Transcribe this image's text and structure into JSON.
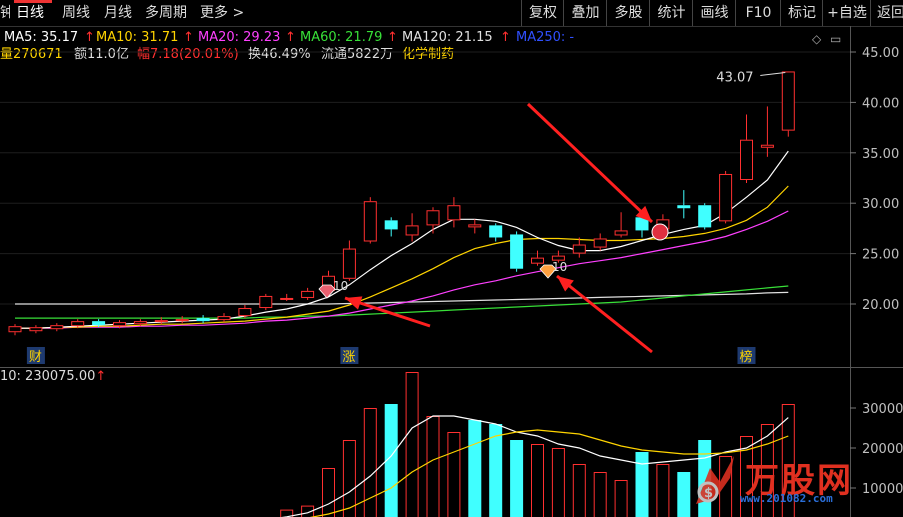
{
  "toolbar": {
    "left_tabs": [
      {
        "label": "日线",
        "active": true
      },
      {
        "label": "周线",
        "active": false
      },
      {
        "label": "月线",
        "active": false
      },
      {
        "label": "多周期",
        "active": false
      },
      {
        "label": "更多 >",
        "active": false
      }
    ],
    "left_cut_label": "钟",
    "right_buttons": [
      "复权",
      "叠加",
      "多股",
      "统计",
      "画线",
      "F10",
      "标记",
      "+自选",
      "返回"
    ]
  },
  "ma_legend": [
    {
      "label": "MA5: 35.17",
      "color": "#ffffff"
    },
    {
      "label": "MA10: 31.71",
      "color": "#ffd400"
    },
    {
      "label": "MA20: 29.23",
      "color": "#ff40ff"
    },
    {
      "label": "MA60: 21.79",
      "color": "#38e038"
    },
    {
      "label": "MA120: 21.15",
      "color": "#e0e0e0"
    },
    {
      "label": "MA250: -",
      "color": "#3050ff"
    }
  ],
  "info_line": {
    "vol": "量270671",
    "amount": "额11.0亿",
    "change_pct": "幅7.18(20.01%)",
    "turnover": "换46.49%",
    "float_shares": "流通5822万",
    "industry": "化学制药"
  },
  "volume_legend": "10: 230075.00",
  "colors": {
    "up": "#ff3030",
    "down": "#40ffff",
    "ma5": "#ffffff",
    "ma10": "#ffd400",
    "ma20": "#ff40ff",
    "ma60": "#38e038",
    "ma120": "#e0e0e0",
    "arrow": "#ff2020",
    "axis_text": "#c0c0c0"
  },
  "markers": {
    "bottom_labels": [
      {
        "text": "财",
        "day": 1
      },
      {
        "text": "涨",
        "day": 16
      },
      {
        "text": "榜",
        "day": 35
      }
    ],
    "high_label": "43.07",
    "gem_labels": [
      "10",
      "10"
    ]
  },
  "chart_data": [
    {
      "type": "candlestick",
      "title": "",
      "xlabel": "",
      "ylabel": "",
      "ylim": [
        16.8,
        46.5
      ],
      "yticks": [
        "45.00",
        "40.00",
        "35.00",
        "30.00",
        "25.00",
        "20.00"
      ],
      "candles": [
        {
          "o": 17.2,
          "c": 17.8,
          "h": 18.0,
          "l": 16.9
        },
        {
          "o": 17.3,
          "c": 17.7,
          "h": 17.9,
          "l": 17.1
        },
        {
          "o": 17.5,
          "c": 17.9,
          "h": 18.1,
          "l": 17.3
        },
        {
          "o": 17.8,
          "c": 18.3,
          "h": 18.5,
          "l": 17.6
        },
        {
          "o": 18.3,
          "c": 17.9,
          "h": 18.5,
          "l": 17.7
        },
        {
          "o": 17.8,
          "c": 18.2,
          "h": 18.4,
          "l": 17.6
        },
        {
          "o": 18.0,
          "c": 18.3,
          "h": 18.5,
          "l": 17.8
        },
        {
          "o": 18.2,
          "c": 18.4,
          "h": 18.7,
          "l": 18.0
        },
        {
          "o": 18.3,
          "c": 18.5,
          "h": 18.8,
          "l": 18.1
        },
        {
          "o": 18.6,
          "c": 18.3,
          "h": 18.9,
          "l": 18.1
        },
        {
          "o": 18.4,
          "c": 18.8,
          "h": 19.1,
          "l": 18.2
        },
        {
          "o": 18.8,
          "c": 19.6,
          "h": 19.9,
          "l": 18.6
        },
        {
          "o": 19.6,
          "c": 20.8,
          "h": 21.0,
          "l": 19.4
        },
        {
          "o": 20.6,
          "c": 20.6,
          "h": 21.0,
          "l": 20.3
        },
        {
          "o": 20.6,
          "c": 21.3,
          "h": 21.6,
          "l": 20.4
        },
        {
          "o": 21.3,
          "c": 22.8,
          "h": 23.3,
          "l": 21.1
        },
        {
          "o": 22.5,
          "c": 25.5,
          "h": 26.3,
          "l": 22.3
        },
        {
          "o": 26.2,
          "c": 30.2,
          "h": 30.6,
          "l": 26.0
        },
        {
          "o": 28.3,
          "c": 27.4,
          "h": 28.6,
          "l": 26.7
        },
        {
          "o": 26.8,
          "c": 27.8,
          "h": 29.0,
          "l": 26.2
        },
        {
          "o": 27.8,
          "c": 29.3,
          "h": 29.6,
          "l": 27.0
        },
        {
          "o": 28.3,
          "c": 29.8,
          "h": 30.6,
          "l": 27.6
        },
        {
          "o": 27.6,
          "c": 27.9,
          "h": 28.4,
          "l": 27.0
        },
        {
          "o": 27.8,
          "c": 26.6,
          "h": 28.0,
          "l": 26.2
        },
        {
          "o": 26.9,
          "c": 23.5,
          "h": 27.2,
          "l": 23.2
        },
        {
          "o": 24.0,
          "c": 24.6,
          "h": 25.3,
          "l": 23.8
        },
        {
          "o": 24.3,
          "c": 24.8,
          "h": 25.3,
          "l": 24.1
        },
        {
          "o": 25.0,
          "c": 25.9,
          "h": 26.6,
          "l": 24.6
        },
        {
          "o": 25.6,
          "c": 26.5,
          "h": 27.0,
          "l": 25.3
        },
        {
          "o": 26.8,
          "c": 27.3,
          "h": 29.1,
          "l": 26.6
        },
        {
          "o": 28.6,
          "c": 27.3,
          "h": 28.9,
          "l": 26.6
        },
        {
          "o": 27.4,
          "c": 28.4,
          "h": 28.9,
          "l": 27.1
        },
        {
          "o": 29.8,
          "c": 29.5,
          "h": 31.3,
          "l": 28.5
        },
        {
          "o": 29.8,
          "c": 27.6,
          "h": 30.0,
          "l": 27.4
        },
        {
          "o": 28.2,
          "c": 32.9,
          "h": 33.2,
          "l": 28.0
        },
        {
          "o": 32.3,
          "c": 36.3,
          "h": 38.8,
          "l": 32.0
        },
        {
          "o": 35.5,
          "c": 35.8,
          "h": 39.6,
          "l": 34.6
        },
        {
          "o": 37.2,
          "c": 43.07,
          "h": 43.07,
          "l": 36.6
        }
      ],
      "down_days": [
        4,
        9,
        18,
        22,
        23,
        24,
        30,
        32,
        33
      ],
      "ma": {
        "MA5": [
          17.6,
          17.6,
          17.7,
          17.8,
          17.9,
          18.0,
          18.1,
          18.2,
          18.3,
          18.4,
          18.5,
          18.8,
          19.2,
          19.5,
          20.0,
          20.7,
          21.9,
          23.4,
          24.8,
          26.0,
          27.4,
          28.4,
          28.4,
          28.2,
          27.6,
          26.6,
          25.8,
          25.3,
          25.3,
          25.7,
          26.3,
          26.9,
          27.4,
          27.8,
          29.0,
          30.6,
          32.3,
          35.17
        ],
        "MA10": [
          17.6,
          17.6,
          17.7,
          17.7,
          17.8,
          17.8,
          17.9,
          18.0,
          18.0,
          18.1,
          18.2,
          18.3,
          18.5,
          18.7,
          19.0,
          19.3,
          19.9,
          20.7,
          21.6,
          22.5,
          23.5,
          24.6,
          25.5,
          26.0,
          26.4,
          26.5,
          26.5,
          26.4,
          26.3,
          26.3,
          26.4,
          26.5,
          26.7,
          27.0,
          27.5,
          28.3,
          29.6,
          31.71
        ],
        "MA20": [
          17.6,
          17.6,
          17.6,
          17.7,
          17.7,
          17.7,
          17.8,
          17.8,
          17.9,
          17.9,
          18.0,
          18.1,
          18.3,
          18.4,
          18.6,
          18.8,
          19.1,
          19.5,
          19.9,
          20.3,
          20.8,
          21.4,
          21.9,
          22.3,
          22.8,
          23.2,
          23.6,
          24.0,
          24.3,
          24.6,
          25.0,
          25.4,
          25.8,
          26.2,
          26.7,
          27.4,
          28.2,
          29.23
        ],
        "MA60": [
          18.6,
          18.6,
          18.6,
          18.6,
          18.6,
          18.6,
          18.6,
          18.6,
          18.6,
          18.6,
          18.6,
          18.6,
          18.7,
          18.7,
          18.8,
          18.8,
          18.9,
          19.0,
          19.1,
          19.2,
          19.3,
          19.4,
          19.5,
          19.6,
          19.7,
          19.8,
          19.9,
          20.0,
          20.1,
          20.2,
          20.4,
          20.6,
          20.8,
          21.0,
          21.2,
          21.4,
          21.6,
          21.79
        ],
        "MA120": [
          20.0,
          20.0,
          20.0,
          20.0,
          20.0,
          20.0,
          20.0,
          20.0,
          20.0,
          20.0,
          20.0,
          20.0,
          20.0,
          20.0,
          20.0,
          20.0,
          20.05,
          20.1,
          20.15,
          20.2,
          20.25,
          20.3,
          20.35,
          20.4,
          20.45,
          20.5,
          20.55,
          20.6,
          20.65,
          20.7,
          20.75,
          20.8,
          20.85,
          20.9,
          20.95,
          21.0,
          21.1,
          21.15
        ]
      }
    },
    {
      "type": "bar",
      "title": "",
      "xlabel": "",
      "ylabel": "",
      "ylim": [
        0,
        40000
      ],
      "yticks": [
        "30000",
        "20000",
        "10000"
      ],
      "values": [
        300,
        400,
        500,
        500,
        400,
        600,
        700,
        800,
        900,
        800,
        1200,
        2000,
        2600,
        4600,
        5600,
        15000,
        22000,
        30000,
        31000,
        39000,
        28000,
        24000,
        27000,
        26000,
        22000,
        21000,
        20000,
        16000,
        14000,
        12000,
        19000,
        16000,
        14000,
        22000,
        18000,
        23000,
        26000,
        31000
      ],
      "ma_lines": {
        "VMA5": [
          500,
          500,
          500,
          500,
          500,
          600,
          700,
          800,
          900,
          1000,
          1200,
          1500,
          2000,
          2800,
          3800,
          6000,
          9000,
          13000,
          18000,
          25000,
          28000,
          28000,
          27000,
          26000,
          24000,
          23000,
          21000,
          20000,
          18000,
          17000,
          16000,
          16500,
          17000,
          17500,
          19000,
          20000,
          23000,
          27600
        ],
        "VMA10": [
          500,
          500,
          500,
          500,
          500,
          500,
          600,
          700,
          800,
          900,
          1000,
          1200,
          1500,
          1900,
          2500,
          3500,
          5000,
          7500,
          10000,
          14000,
          17000,
          19000,
          21000,
          23000,
          24000,
          24500,
          24000,
          23500,
          22000,
          20500,
          19500,
          19000,
          18500,
          18500,
          18800,
          19500,
          21000,
          23007
        ]
      }
    }
  ]
}
